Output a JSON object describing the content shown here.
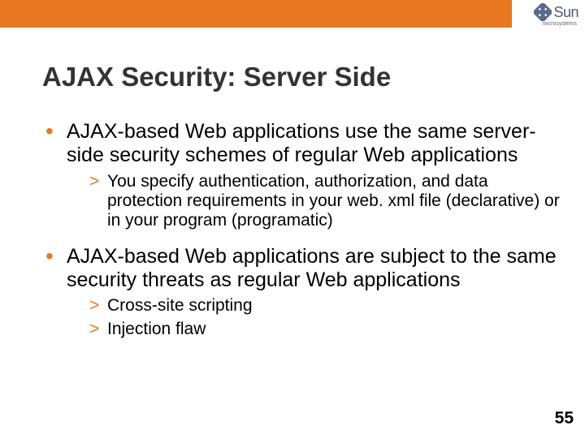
{
  "header": {
    "logo_text": "Sun",
    "logo_sublabel": "microsystems"
  },
  "slide": {
    "title": "AJAX Security: Server Side",
    "bullets": [
      {
        "text": "AJAX-based Web applications use the same server-side security schemes of regular Web applications",
        "sub": [
          "You specify authentication, authorization, and data protection requirements in your web. xml file (declarative) or in your program (programatic)"
        ]
      },
      {
        "text": "AJAX-based Web applications are subject to the same security threats as regular Web applications",
        "sub": [
          "Cross-site scripting",
          "Injection flaw"
        ]
      }
    ],
    "page_number": "55"
  },
  "colors": {
    "accent": "#e87722",
    "title": "#333333",
    "body": "#000000"
  }
}
